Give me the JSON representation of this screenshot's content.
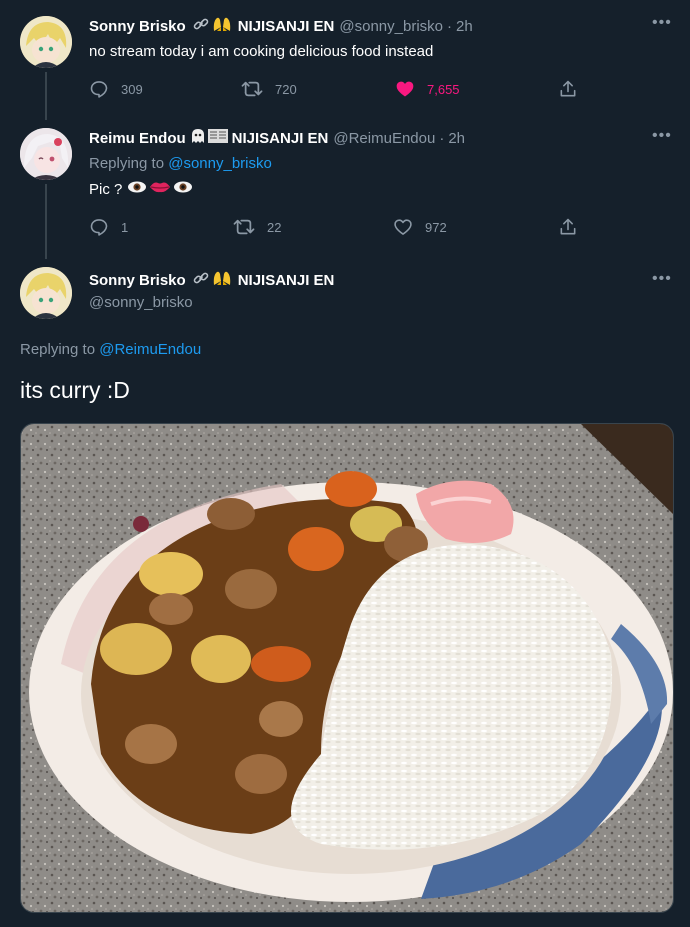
{
  "tweets": [
    {
      "display_name": "Sonny Brisko",
      "org": "NIJISANJI EN",
      "handle": "@sonny_brisko",
      "sep": "·",
      "time": "2h",
      "text": "no stream today i am cooking delicious food instead",
      "replies": "309",
      "retweets": "720",
      "likes": "7,655",
      "liked": true
    },
    {
      "display_name": "Reimu Endou",
      "org": "NIJISANJI EN",
      "handle": "@ReimuEndou",
      "sep": "·",
      "time": "2h",
      "replying_label": "Replying to",
      "replying_to": "@sonny_brisko",
      "text": "Pic ?",
      "replies": "1",
      "retweets": "22",
      "likes": "972",
      "liked": false
    }
  ],
  "main": {
    "display_name": "Sonny Brisko",
    "org": "NIJISANJI EN",
    "handle": "@sonny_brisko",
    "replying_label": "Replying to",
    "replying_to": "@ReimuEndou",
    "text": "its curry :D"
  },
  "colors": {
    "background": "#15202b",
    "accent": "#1d9bf0",
    "like": "#f91880",
    "muted": "#8b98a5"
  },
  "icons": [
    "reply-icon",
    "retweet-icon",
    "heart-icon",
    "share-icon",
    "more-icon",
    "link-icon",
    "hands-icon",
    "ghost-icon",
    "eye-icon",
    "lips-icon"
  ]
}
